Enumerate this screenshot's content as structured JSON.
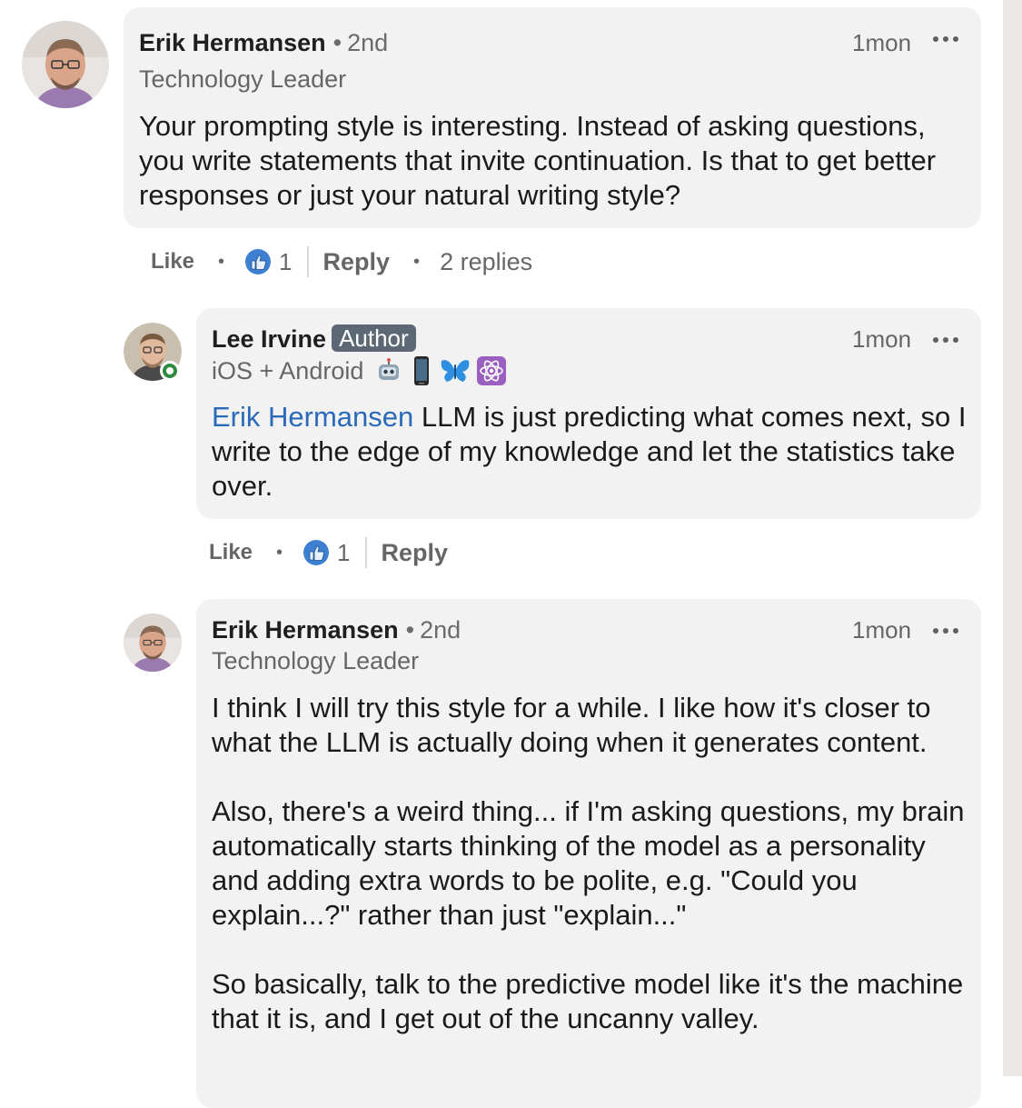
{
  "comments": [
    {
      "author": "Erik Hermansen",
      "separator": "•",
      "degree": "2nd",
      "headline": "Technology Leader",
      "time": "1mon",
      "body": "Your prompting style is interesting. Instead of asking questions, you write statements that invite continuation. Is that to get better responses or just your natural writing style?",
      "actions": {
        "like": "Like",
        "dot": "•",
        "reaction_count": "1",
        "reply": "Reply",
        "dot2": "•",
        "replies": "2 replies"
      }
    },
    {
      "author": "Lee Irvine",
      "badge": "Author",
      "headline": "iOS + Android",
      "headline_emojis": [
        "robot-icon",
        "phone-icon",
        "butterfly-icon",
        "atom-icon"
      ],
      "time": "1mon",
      "mention": "Erik Hermansen",
      "body": " LLM is just predicting what comes next, so I write to the edge of my knowledge and let the statistics take over.",
      "online_status": "online",
      "actions": {
        "like": "Like",
        "dot": "•",
        "reaction_count": "1",
        "reply": "Reply"
      }
    },
    {
      "author": "Erik Hermansen",
      "separator": "•",
      "degree": "2nd",
      "headline": "Technology Leader",
      "time": "1mon",
      "paragraphs": [
        "I think I will try this style for a while. I like how it's closer to what the LLM is actually doing when it generates content.",
        "Also, there's a weird thing... if I'm asking questions, my brain automatically starts thinking of the model as a personality and adding extra words to be polite, e.g. \"Could you explain...?\" rather than just \"explain...\"",
        "So basically, talk to the predictive model like it's the machine that it is, and I get out of the uncanny valley."
      ]
    }
  ],
  "colors": {
    "bubble": "#f2f2f2",
    "mention": "#2a6ab8",
    "badge": "#5c6873",
    "reaction": "#3d7fd1",
    "online": "#2e8a3f"
  }
}
